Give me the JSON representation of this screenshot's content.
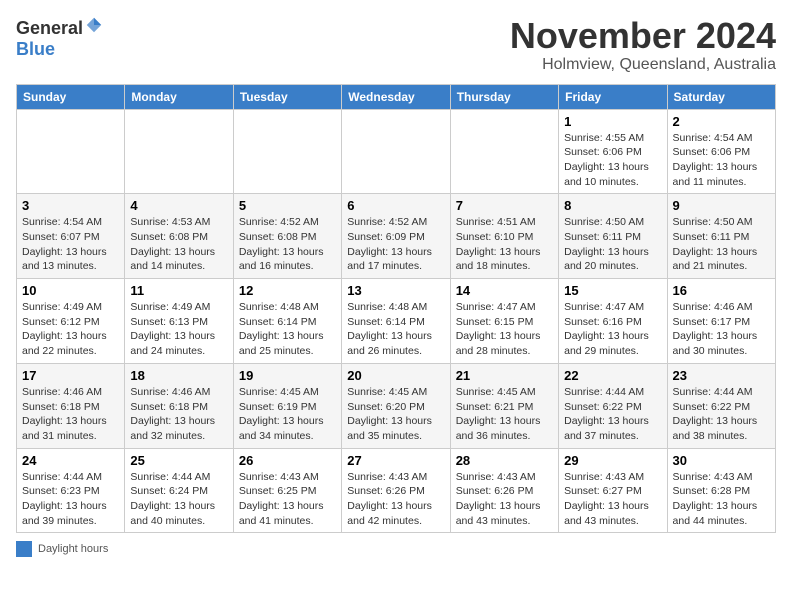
{
  "logo": {
    "general": "General",
    "blue": "Blue"
  },
  "title": {
    "month": "November 2024",
    "location": "Holmview, Queensland, Australia"
  },
  "days_of_week": [
    "Sunday",
    "Monday",
    "Tuesday",
    "Wednesday",
    "Thursday",
    "Friday",
    "Saturday"
  ],
  "weeks": [
    [
      {
        "day": "",
        "info": ""
      },
      {
        "day": "",
        "info": ""
      },
      {
        "day": "",
        "info": ""
      },
      {
        "day": "",
        "info": ""
      },
      {
        "day": "",
        "info": ""
      },
      {
        "day": "1",
        "info": "Sunrise: 4:55 AM\nSunset: 6:06 PM\nDaylight: 13 hours and 10 minutes."
      },
      {
        "day": "2",
        "info": "Sunrise: 4:54 AM\nSunset: 6:06 PM\nDaylight: 13 hours and 11 minutes."
      }
    ],
    [
      {
        "day": "3",
        "info": "Sunrise: 4:54 AM\nSunset: 6:07 PM\nDaylight: 13 hours and 13 minutes."
      },
      {
        "day": "4",
        "info": "Sunrise: 4:53 AM\nSunset: 6:08 PM\nDaylight: 13 hours and 14 minutes."
      },
      {
        "day": "5",
        "info": "Sunrise: 4:52 AM\nSunset: 6:08 PM\nDaylight: 13 hours and 16 minutes."
      },
      {
        "day": "6",
        "info": "Sunrise: 4:52 AM\nSunset: 6:09 PM\nDaylight: 13 hours and 17 minutes."
      },
      {
        "day": "7",
        "info": "Sunrise: 4:51 AM\nSunset: 6:10 PM\nDaylight: 13 hours and 18 minutes."
      },
      {
        "day": "8",
        "info": "Sunrise: 4:50 AM\nSunset: 6:11 PM\nDaylight: 13 hours and 20 minutes."
      },
      {
        "day": "9",
        "info": "Sunrise: 4:50 AM\nSunset: 6:11 PM\nDaylight: 13 hours and 21 minutes."
      }
    ],
    [
      {
        "day": "10",
        "info": "Sunrise: 4:49 AM\nSunset: 6:12 PM\nDaylight: 13 hours and 22 minutes."
      },
      {
        "day": "11",
        "info": "Sunrise: 4:49 AM\nSunset: 6:13 PM\nDaylight: 13 hours and 24 minutes."
      },
      {
        "day": "12",
        "info": "Sunrise: 4:48 AM\nSunset: 6:14 PM\nDaylight: 13 hours and 25 minutes."
      },
      {
        "day": "13",
        "info": "Sunrise: 4:48 AM\nSunset: 6:14 PM\nDaylight: 13 hours and 26 minutes."
      },
      {
        "day": "14",
        "info": "Sunrise: 4:47 AM\nSunset: 6:15 PM\nDaylight: 13 hours and 28 minutes."
      },
      {
        "day": "15",
        "info": "Sunrise: 4:47 AM\nSunset: 6:16 PM\nDaylight: 13 hours and 29 minutes."
      },
      {
        "day": "16",
        "info": "Sunrise: 4:46 AM\nSunset: 6:17 PM\nDaylight: 13 hours and 30 minutes."
      }
    ],
    [
      {
        "day": "17",
        "info": "Sunrise: 4:46 AM\nSunset: 6:18 PM\nDaylight: 13 hours and 31 minutes."
      },
      {
        "day": "18",
        "info": "Sunrise: 4:46 AM\nSunset: 6:18 PM\nDaylight: 13 hours and 32 minutes."
      },
      {
        "day": "19",
        "info": "Sunrise: 4:45 AM\nSunset: 6:19 PM\nDaylight: 13 hours and 34 minutes."
      },
      {
        "day": "20",
        "info": "Sunrise: 4:45 AM\nSunset: 6:20 PM\nDaylight: 13 hours and 35 minutes."
      },
      {
        "day": "21",
        "info": "Sunrise: 4:45 AM\nSunset: 6:21 PM\nDaylight: 13 hours and 36 minutes."
      },
      {
        "day": "22",
        "info": "Sunrise: 4:44 AM\nSunset: 6:22 PM\nDaylight: 13 hours and 37 minutes."
      },
      {
        "day": "23",
        "info": "Sunrise: 4:44 AM\nSunset: 6:22 PM\nDaylight: 13 hours and 38 minutes."
      }
    ],
    [
      {
        "day": "24",
        "info": "Sunrise: 4:44 AM\nSunset: 6:23 PM\nDaylight: 13 hours and 39 minutes."
      },
      {
        "day": "25",
        "info": "Sunrise: 4:44 AM\nSunset: 6:24 PM\nDaylight: 13 hours and 40 minutes."
      },
      {
        "day": "26",
        "info": "Sunrise: 4:43 AM\nSunset: 6:25 PM\nDaylight: 13 hours and 41 minutes."
      },
      {
        "day": "27",
        "info": "Sunrise: 4:43 AM\nSunset: 6:26 PM\nDaylight: 13 hours and 42 minutes."
      },
      {
        "day": "28",
        "info": "Sunrise: 4:43 AM\nSunset: 6:26 PM\nDaylight: 13 hours and 43 minutes."
      },
      {
        "day": "29",
        "info": "Sunrise: 4:43 AM\nSunset: 6:27 PM\nDaylight: 13 hours and 43 minutes."
      },
      {
        "day": "30",
        "info": "Sunrise: 4:43 AM\nSunset: 6:28 PM\nDaylight: 13 hours and 44 minutes."
      }
    ]
  ],
  "footer": {
    "label": "Daylight hours"
  }
}
